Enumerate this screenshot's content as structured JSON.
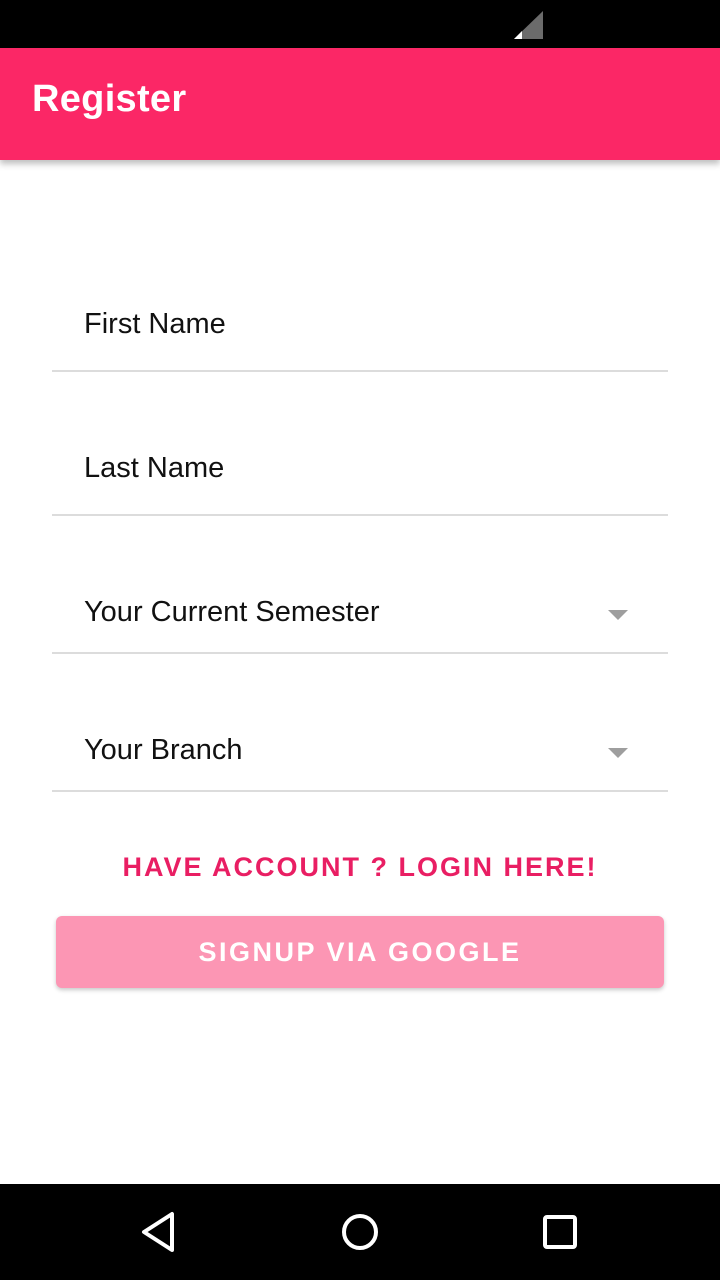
{
  "status_bar": {
    "signal_icon": "cell-signal-icon"
  },
  "app_bar": {
    "title": "Register",
    "color": "#fb2766"
  },
  "form": {
    "first_name": {
      "label": "First Name"
    },
    "last_name": {
      "label": "Last Name"
    },
    "semester": {
      "label": "Your Current Semester",
      "icon": "dropdown-arrow-icon"
    },
    "branch": {
      "label": "Your Branch",
      "icon": "dropdown-arrow-icon"
    }
  },
  "actions": {
    "login_link": "HAVE ACCOUNT ? LOGIN HERE!",
    "login_link_color": "#e91e63",
    "google_button": "SIGNUP VIA GOOGLE",
    "google_button_color": "#fc96b4"
  },
  "nav_bar": {
    "back_icon": "back-triangle-icon",
    "home_icon": "home-circle-icon",
    "recents_icon": "recents-square-icon"
  }
}
